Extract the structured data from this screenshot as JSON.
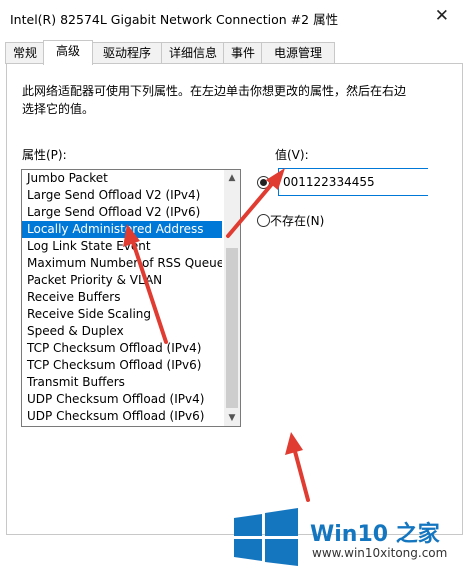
{
  "window": {
    "title": "Intel(R) 82574L Gigabit Network Connection #2 属性",
    "close_glyph": "✕"
  },
  "tabs": [
    {
      "label": "常规"
    },
    {
      "label": "高级"
    },
    {
      "label": "驱动程序"
    },
    {
      "label": "详细信息"
    },
    {
      "label": "事件"
    },
    {
      "label": "电源管理"
    }
  ],
  "active_tab": "高级",
  "description": "此网络适配器可使用下列属性。在左边单击你想更改的属性，然后在右边选择它的值。",
  "property_label": "属性(P):",
  "value_label": "值(V):",
  "properties": [
    {
      "label": "Jumbo Packet"
    },
    {
      "label": "Large Send Offload V2 (IPv4)"
    },
    {
      "label": "Large Send Offload V2 (IPv6)"
    },
    {
      "label": "Locally Administered Address"
    },
    {
      "label": "Log Link State Event"
    },
    {
      "label": "Maximum Number of RSS Queue"
    },
    {
      "label": "Packet Priority & VLAN"
    },
    {
      "label": "Receive Buffers"
    },
    {
      "label": "Receive Side Scaling"
    },
    {
      "label": "Speed & Duplex"
    },
    {
      "label": "TCP Checksum Offload (IPv4)"
    },
    {
      "label": "TCP Checksum Offload (IPv6)"
    },
    {
      "label": "Transmit Buffers"
    },
    {
      "label": "UDP Checksum Offload (IPv4)"
    },
    {
      "label": "UDP Checksum Offload (IPv6)"
    }
  ],
  "selected_property": "Locally Administered Address",
  "value_input": "001122334455",
  "not_present_label": "不存在(N)",
  "scroll": {
    "up_glyph": "▲",
    "down_glyph": "▼"
  },
  "logo": {
    "brand": "Win10 之家",
    "url": "www.win10xitong.com"
  },
  "colors": {
    "selection": "#0078d7",
    "arrow": "#e03c31",
    "logo_blue": "#1576c0"
  }
}
